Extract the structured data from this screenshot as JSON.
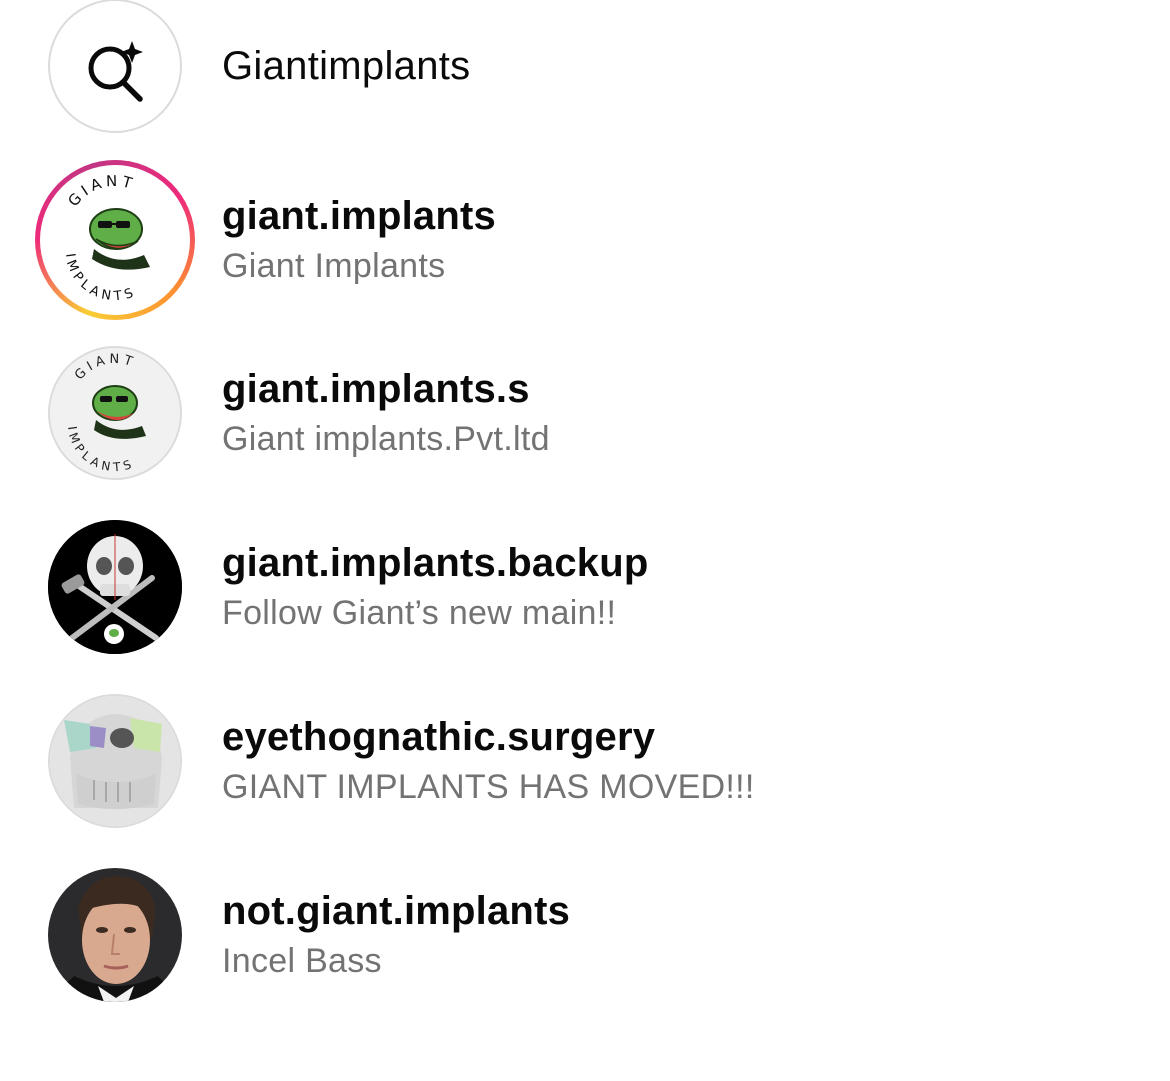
{
  "search_suggestion": {
    "icon": "ai-search-sparkle-icon",
    "query": "Giantimplants"
  },
  "results": [
    {
      "username": "giant.implants",
      "fullname": "Giant Implants",
      "has_story": true,
      "avatar": "pepe-giant-implants-logo"
    },
    {
      "username": "giant.implants.s",
      "fullname": "Giant implants.Pvt.ltd",
      "has_story": false,
      "avatar": "pepe-giant-implants-logo"
    },
    {
      "username": "giant.implants.backup",
      "fullname": "Follow Giant’s new main!!",
      "has_story": false,
      "avatar": "skull-crossed-tools-logo"
    },
    {
      "username": "eyethognathic.surgery",
      "fullname": "GIANT IMPLANTS HAS MOVED!!!",
      "has_story": false,
      "avatar": "skull-3d-render"
    },
    {
      "username": "not.giant.implants",
      "fullname": "Incel Bass",
      "has_story": false,
      "avatar": "face-photo"
    }
  ],
  "logo_text": {
    "top": "GIANT",
    "bottom": "IMPLANTS"
  },
  "colors": {
    "primary_text": "#0a0a0a",
    "secondary_text": "#737373",
    "story_ring": "#ee2a7b"
  }
}
